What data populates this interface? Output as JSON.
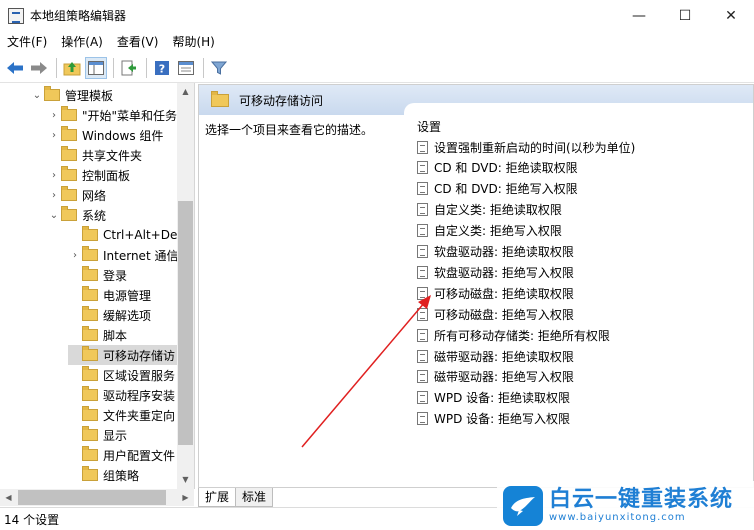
{
  "window": {
    "title": "本地组策略编辑器",
    "minimize": "—",
    "maximize": "☐",
    "close": "✕"
  },
  "menu": [
    "文件(F)",
    "操作(A)",
    "查看(V)",
    "帮助(H)"
  ],
  "toolbar_icons": [
    "back-arrow-icon",
    "forward-arrow-icon",
    "up-folder-icon",
    "show-hide-tree-icon",
    "export-icon",
    "help-icon",
    "properties-icon",
    "filter-icon"
  ],
  "tree": [
    {
      "label": "管理模板",
      "exp": "⌄"
    },
    {
      "label": "\"开始\"菜单和任务",
      "exp": "›"
    },
    {
      "label": "Windows 组件",
      "exp": "›"
    },
    {
      "label": "共享文件夹",
      "exp": ""
    },
    {
      "label": "控制面板",
      "exp": "›"
    },
    {
      "label": "网络",
      "exp": "›"
    },
    {
      "label": "系统",
      "exp": "⌄"
    },
    {
      "label": "Ctrl+Alt+Del",
      "exp": ""
    },
    {
      "label": "Internet 通信",
      "exp": "›"
    },
    {
      "label": "登录",
      "exp": ""
    },
    {
      "label": "电源管理",
      "exp": ""
    },
    {
      "label": "缓解选项",
      "exp": ""
    },
    {
      "label": "脚本",
      "exp": ""
    },
    {
      "label": "可移动存储访",
      "exp": ""
    },
    {
      "label": "区域设置服务",
      "exp": ""
    },
    {
      "label": "驱动程序安装",
      "exp": ""
    },
    {
      "label": "文件夹重定向",
      "exp": ""
    },
    {
      "label": "显示",
      "exp": ""
    },
    {
      "label": "用户配置文件",
      "exp": ""
    },
    {
      "label": "组策略",
      "exp": ""
    }
  ],
  "panel": {
    "header": "可移动存储访问",
    "description": "选择一个项目来查看它的描述。",
    "column": "设置",
    "items": [
      "设置强制重新启动的时间(以秒为单位)",
      "CD 和 DVD: 拒绝读取权限",
      "CD 和 DVD: 拒绝写入权限",
      "自定义类: 拒绝读取权限",
      "自定义类: 拒绝写入权限",
      "软盘驱动器: 拒绝读取权限",
      "软盘驱动器: 拒绝写入权限",
      "可移动磁盘: 拒绝读取权限",
      "可移动磁盘: 拒绝写入权限",
      "所有可移动存储类: 拒绝所有权限",
      "磁带驱动器: 拒绝读取权限",
      "磁带驱动器: 拒绝写入权限",
      "WPD 设备: 拒绝读取权限",
      "WPD 设备: 拒绝写入权限"
    ]
  },
  "tabs": [
    "扩展",
    "标准"
  ],
  "status": "14 个设置",
  "watermark": {
    "name": "白云一键重装系统",
    "url": "www.baiyunxitong.com"
  },
  "colors": {
    "accent": "#1f7fd4",
    "header_gradient_top": "#dfe9f6",
    "arrow": "#e02020"
  }
}
